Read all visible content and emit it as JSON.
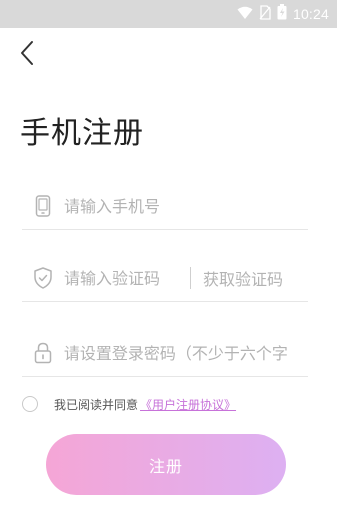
{
  "status_bar": {
    "time": "10:24",
    "icons": [
      "wifi-icon",
      "no-sim-icon",
      "battery-icon"
    ]
  },
  "header": {
    "back_icon": "chevron-left-icon",
    "title": "手机注册"
  },
  "form": {
    "phone": {
      "icon": "phone-icon",
      "placeholder": "请输入手机号",
      "value": ""
    },
    "code": {
      "icon": "shield-check-icon",
      "placeholder": "请输入验证码",
      "value": "",
      "get_code_label": "获取验证码"
    },
    "password": {
      "icon": "lock-icon",
      "placeholder": "请设置登录密码（不少于六个字",
      "value": ""
    }
  },
  "agreement": {
    "checked": false,
    "text": "我已阅读并同意",
    "link_label": "《用户注册协议》"
  },
  "submit": {
    "label": "注册"
  },
  "colors": {
    "status_bar_bg": "#d9d9d9",
    "accent_link": "#c772d9",
    "button_gradient_start": "#f5a6d6",
    "button_gradient_end": "#ddb0f2",
    "placeholder": "#b3b3b3"
  }
}
